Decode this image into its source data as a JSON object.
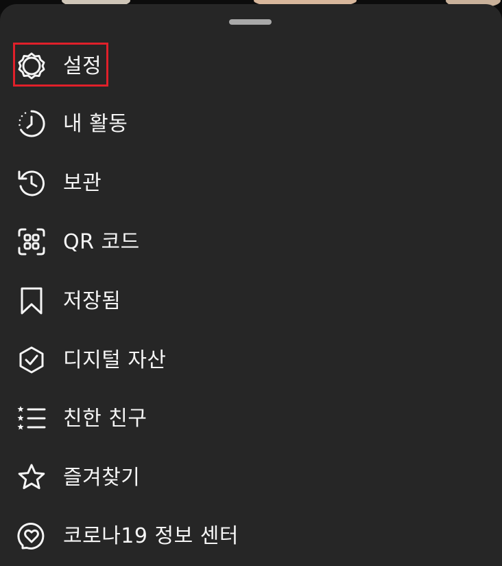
{
  "menu": {
    "items": [
      {
        "key": "settings",
        "label": "설정",
        "icon": "settings-gear-icon"
      },
      {
        "key": "activity",
        "label": "내 활동",
        "icon": "activity-clock-icon"
      },
      {
        "key": "archive",
        "label": "보관",
        "icon": "archive-history-icon"
      },
      {
        "key": "qr",
        "label": "QR 코드",
        "icon": "qr-code-icon"
      },
      {
        "key": "saved",
        "label": "저장됨",
        "icon": "bookmark-icon"
      },
      {
        "key": "digital",
        "label": "디지털 자산",
        "icon": "shield-check-icon"
      },
      {
        "key": "close-friends",
        "label": "친한 친구",
        "icon": "star-list-icon"
      },
      {
        "key": "favorites",
        "label": "즐겨찾기",
        "icon": "star-icon"
      },
      {
        "key": "covid",
        "label": "코로나19 정보 센터",
        "icon": "heart-circle-icon"
      }
    ]
  },
  "colors": {
    "sheet_background": "#262626",
    "text": "#f5f5f5",
    "highlight_border": "#e0202a",
    "handle": "#a8a8a8"
  }
}
